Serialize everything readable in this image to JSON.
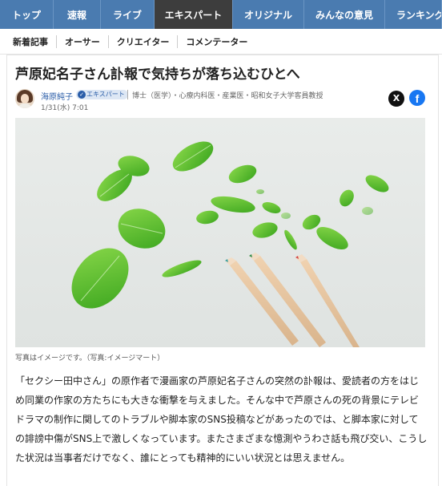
{
  "nav": {
    "tabs": [
      {
        "label": "トップ",
        "active": false
      },
      {
        "label": "速報",
        "active": false
      },
      {
        "label": "ライブ",
        "active": false
      },
      {
        "label": "エキスパート",
        "active": true
      },
      {
        "label": "オリジナル",
        "active": false
      },
      {
        "label": "みんなの意見",
        "active": false
      },
      {
        "label": "ランキング",
        "active": false
      }
    ],
    "subtabs": [
      "新着記事",
      "オーサー",
      "クリエイター",
      "コメンテーター"
    ]
  },
  "article": {
    "title": "芦原妃名子さん訃報で気持ちが落ち込むひとへ",
    "author": {
      "name": "海原純子",
      "badge": "エキスパート",
      "description": "博士（医学）・心療内科医・産業医・昭和女子大学客員教授",
      "date": "1/31(水) 7:01"
    },
    "share": {
      "x_label": "X",
      "facebook_label": "f"
    },
    "photo": {
      "alt_icons": [
        "leaf-icon",
        "pencil-icon"
      ]
    },
    "caption": "写真はイメージです。（写真:イメージマート）",
    "body": "「セクシー田中さん」の原作者で漫画家の芦原妃名子さんの突然の訃報は、愛読者の方をはじめ同業の作家の方たちにも大きな衝撃を与えました。そんな中で芦原さんの死の背景にテレビドラマの制作に関してのトラブルや脚本家のSNS投稿などがあったのでは、と脚本家に対しての誹謗中傷がSNS上で激しくなっています。またさまざまな憶測やうわさ話も飛び交い、こうした状況は当事者だけでなく、誰にとっても精神的にいい状況とは思えません。"
  },
  "colors": {
    "nav_bg": "#4a7bb0",
    "nav_active": "#3d3d3d",
    "link": "#2a5da8",
    "leaf": "#5cc12e"
  }
}
